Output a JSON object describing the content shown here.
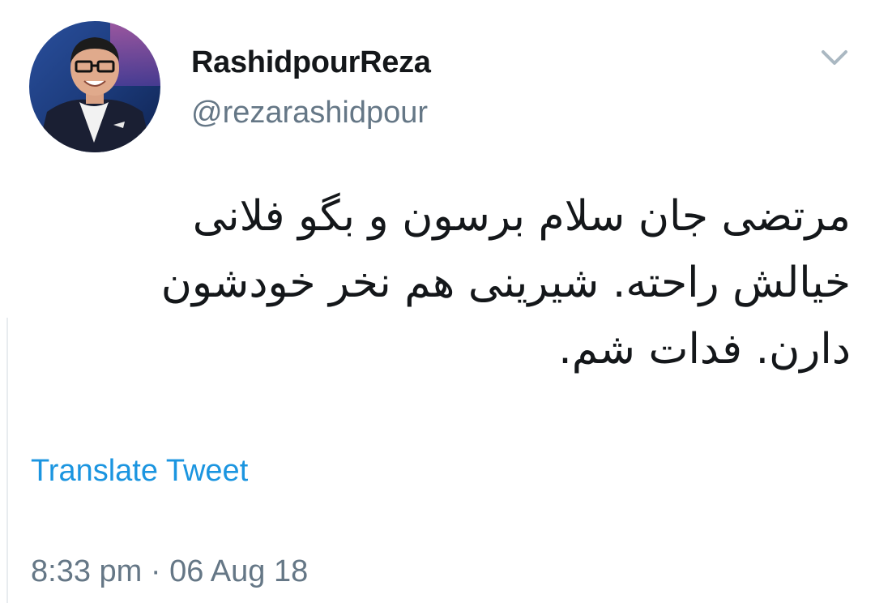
{
  "tweet": {
    "display_name": "RashidpourReza",
    "handle": "@rezarashidpour",
    "text": "مرتضی جان سلام برسون و بگو فلانی\nخیالش راحته. شیرینی هم نخر خودشون\nدارن. فدات شم.",
    "translate_label": "Translate Tweet",
    "timestamp": "8:33 pm · 06 Aug 18"
  },
  "icons": {
    "avatar": "user-avatar",
    "caret": "chevron-down-icon"
  },
  "colors": {
    "text_primary": "#14171a",
    "text_secondary": "#657786",
    "link": "#1b95e0",
    "background": "#ffffff"
  }
}
